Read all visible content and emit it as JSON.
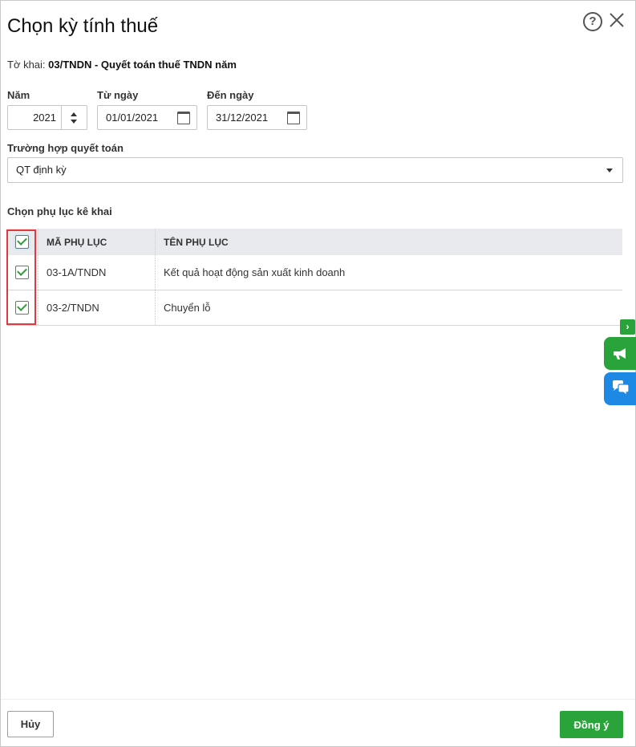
{
  "dialog": {
    "title": "Chọn kỳ tính thuế",
    "declaration_label": "Tờ khai:",
    "declaration_value": "03/TNDN - Quyết toán thuế TNDN năm"
  },
  "form": {
    "year_label": "Năm",
    "year_value": "2021",
    "from_label": "Từ ngày",
    "from_value": "01/01/2021",
    "to_label": "Đến ngày",
    "to_value": "31/12/2021",
    "case_label": "Trường hợp quyết toán",
    "case_value": "QT định kỳ"
  },
  "appendix": {
    "section_title": "Chọn phụ lục kê khai",
    "columns": [
      "MÃ PHỤ LỤC",
      "TÊN PHỤ LỤC"
    ],
    "header_checked": true,
    "rows": [
      {
        "code": "03-1A/TNDN",
        "name": "Kết quả hoạt động sản xuất kinh doanh",
        "checked": true
      },
      {
        "code": "03-2/TNDN",
        "name": "Chuyển lỗ",
        "checked": true
      }
    ]
  },
  "footer": {
    "cancel_label": "Hủy",
    "ok_label": "Đồng ý"
  },
  "side": {
    "toggle_glyph": "›"
  },
  "colors": {
    "accent_green": "#2aa33a",
    "chat_blue": "#1e88e5",
    "highlight_red": "#e0393e"
  },
  "icons": [
    "help-icon",
    "close-icon",
    "calendar-icon",
    "caret-down-icon",
    "megaphone-icon",
    "chat-icon"
  ]
}
